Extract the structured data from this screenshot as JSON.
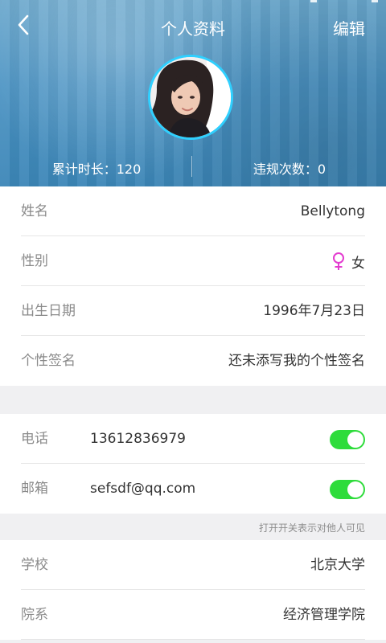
{
  "header": {
    "title": "个人资料",
    "edit_label": "编辑",
    "stats": {
      "total_time": "累计时长：120",
      "violations": "违规次数：0"
    }
  },
  "profile": [
    {
      "label": "姓名",
      "value": "Bellytong"
    },
    {
      "label": "性别",
      "value": "女",
      "icon": "female-icon"
    },
    {
      "label": "出生日期",
      "value": "1996年7月23日"
    },
    {
      "label": "个性签名",
      "value": "还未添写我的个性签名"
    }
  ],
  "contacts": [
    {
      "label": "电话",
      "value": "13612836979",
      "visible": true
    },
    {
      "label": "邮箱",
      "value": "sefsdf@qq.com",
      "visible": true
    }
  ],
  "hint": "打开开关表示对他人可见",
  "education": [
    {
      "label": "学校",
      "value": "北京大学"
    },
    {
      "label": "院系",
      "value": "经济管理学院"
    }
  ],
  "colors": {
    "header_blue": "#4b93c3",
    "avatar_ring": "#2fd0ff",
    "toggle_on": "#2edc3b",
    "female_icon": "#e33bcf"
  }
}
